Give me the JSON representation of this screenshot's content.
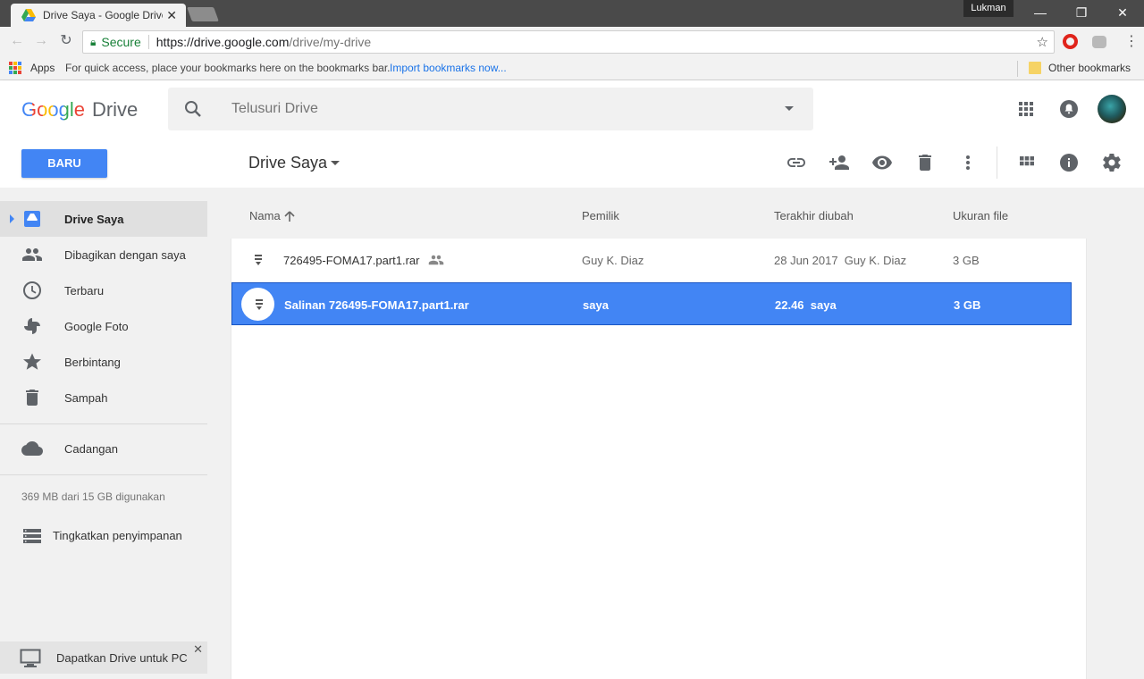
{
  "browser": {
    "tab_title": "Drive Saya - Google Drive",
    "profile_name": "Lukman",
    "url_secure": "Secure",
    "url_host": "https://drive.google.com",
    "url_path": "/drive/my-drive",
    "bookmarks": {
      "apps": "Apps",
      "hint": "For quick access, place your bookmarks here on the bookmarks bar.",
      "import": "Import bookmarks now...",
      "other": "Other bookmarks"
    }
  },
  "drive": {
    "logo_word": "Google",
    "logo_product": "Drive",
    "search_placeholder": "Telusuri Drive",
    "new_button": "BARU",
    "folder_title": "Drive Saya"
  },
  "sidebar": {
    "items": [
      {
        "label": "Drive Saya"
      },
      {
        "label": "Dibagikan dengan saya"
      },
      {
        "label": "Terbaru"
      },
      {
        "label": "Google Foto"
      },
      {
        "label": "Berbintang"
      },
      {
        "label": "Sampah"
      },
      {
        "label": "Cadangan"
      }
    ],
    "storage": "369 MB dari 15 GB digunakan",
    "upgrade": "Tingkatkan penyimpanan",
    "promo": "Dapatkan Drive untuk PC"
  },
  "list": {
    "columns": {
      "name": "Nama",
      "owner": "Pemilik",
      "modified": "Terakhir diubah",
      "size": "Ukuran file"
    },
    "rows": [
      {
        "name": "726495-FOMA17.part1.rar",
        "owner": "Guy K. Diaz",
        "modified": "28 Jun 2017  Guy K. Diaz",
        "size": "3 GB"
      },
      {
        "name": "Salinan 726495-FOMA17.part1.rar",
        "owner": "saya",
        "modified": "22.46  saya",
        "size": "3 GB"
      }
    ]
  },
  "colors": {
    "accent": "#4285f4",
    "sidebar_bg": "#f1f1f1",
    "secure_green": "#188038"
  }
}
